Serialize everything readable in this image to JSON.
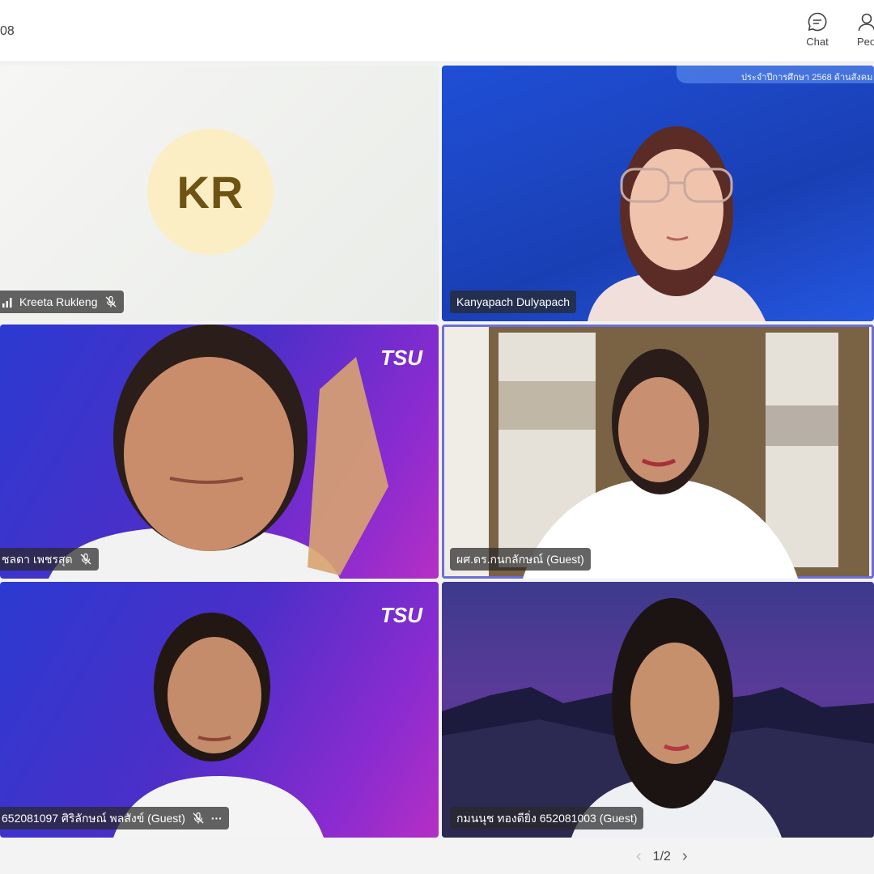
{
  "header": {
    "meeting_title_fragment": "08",
    "chat_label": "Chat",
    "people_label": "Peo"
  },
  "participants": [
    {
      "name": "Kreeta Rukleng",
      "initials": "KR",
      "muted": true,
      "video": false
    },
    {
      "name": "Kanyapach Dulyapach",
      "muted": false,
      "video": true
    },
    {
      "name": "ชลดา เพชรสุด",
      "muted": true,
      "video": true
    },
    {
      "name": "ผศ.ดร.กนกลักษณ์ (Guest)",
      "muted": false,
      "video": true,
      "speaking": true
    },
    {
      "name": "652081097 ศิริลักษณ์ พลสังข์ (Guest)",
      "muted": true,
      "video": true,
      "more": "···"
    },
    {
      "name": "กมนนุช ทองดียิ่ง 652081003 (Guest)",
      "muted": false,
      "video": true
    }
  ],
  "backgrounds": {
    "tile2_banner": "ประจำปีการศึกษา 2568 ด้านสังคม",
    "tsu_logo": "TSU"
  },
  "pagination": {
    "label": "1/2"
  },
  "colors": {
    "avatar_bg": "#fbeec5",
    "avatar_text": "#6e5312",
    "active_border": "#6b6fd6"
  }
}
